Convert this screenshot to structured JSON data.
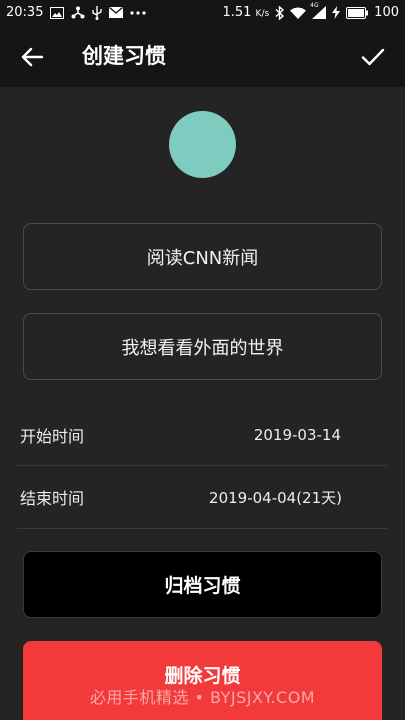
{
  "status_bar": {
    "time": "20:35",
    "speed": "1.51",
    "speed_unit": "K/s",
    "battery": "100",
    "signal_label": "4G",
    "icons": [
      "image-icon",
      "network-share-icon",
      "usb-icon",
      "mail-icon",
      "more-dots-icon",
      "bluetooth-icon",
      "wifi-icon",
      "signal-icon",
      "charging-icon",
      "battery-icon"
    ]
  },
  "app_bar": {
    "title": "创建习惯",
    "back_icon": "arrow-left-icon",
    "confirm_icon": "check-icon"
  },
  "habit": {
    "avatar_color": "#7ecbc0",
    "name": "阅读CNN新闻",
    "description": "我想看看外面的世界"
  },
  "schedule": {
    "start_label": "开始时间",
    "start_value": "2019-03-14",
    "end_label": "结束时间",
    "end_value": "2019-04-04(21天)"
  },
  "actions": {
    "archive_label": "归档习惯",
    "delete_label": "删除习惯",
    "delete_color": "#f33a3a"
  },
  "watermark": "必用手机精选 • BYJSJXY.COM"
}
